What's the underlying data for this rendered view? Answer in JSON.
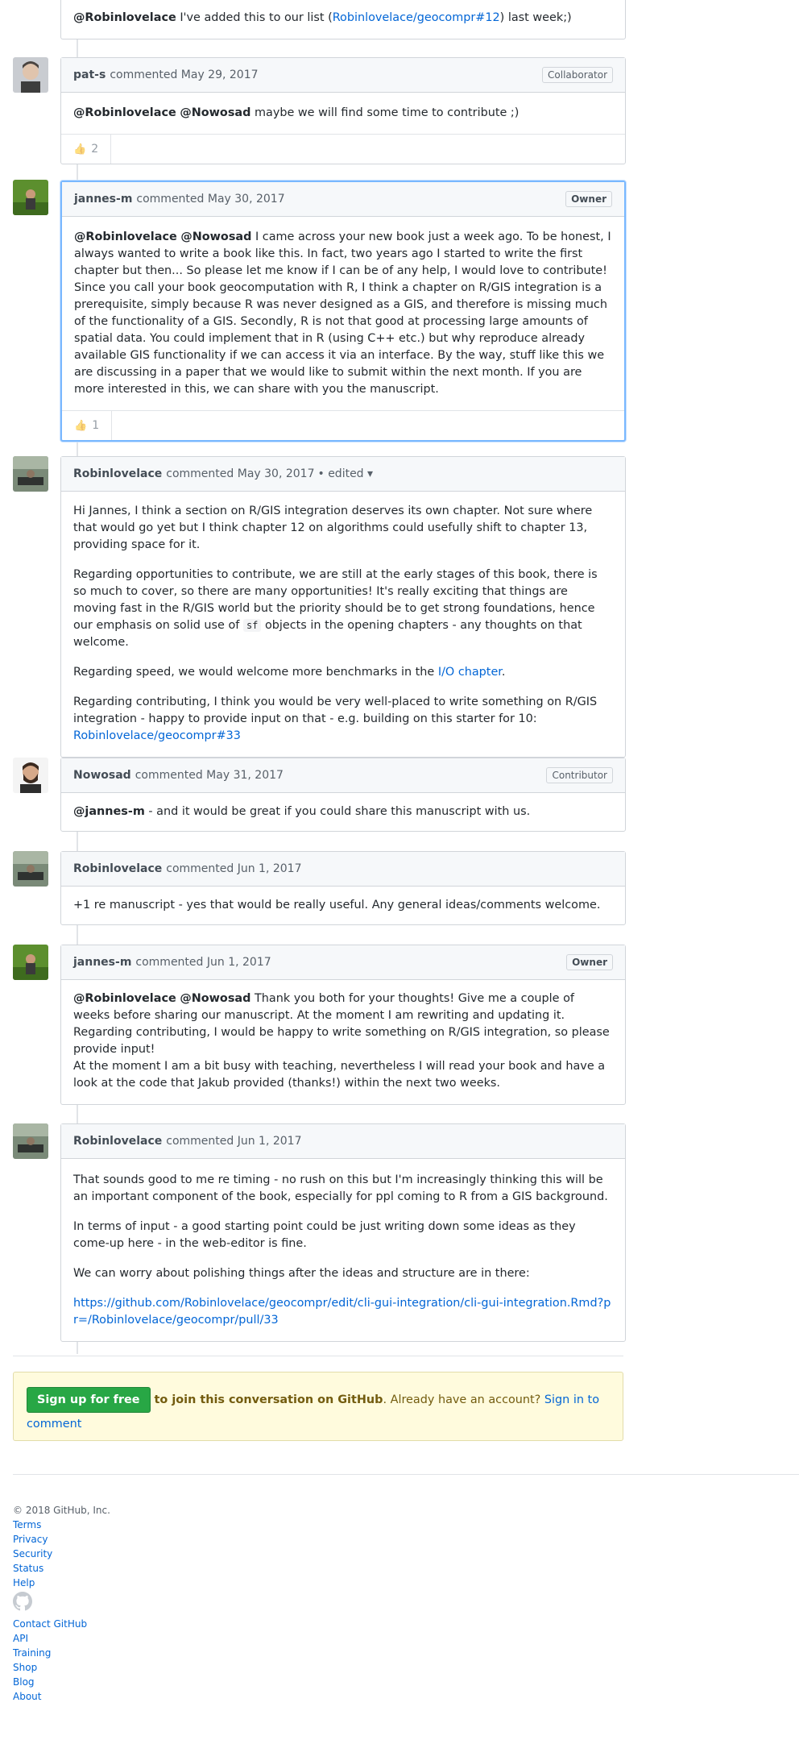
{
  "top_comment": {
    "text_before": "I've added this to our list (",
    "mention": "@Robinlovelace",
    "link": "Robinlovelace/geocompr#12",
    "text_after": ") last week;)"
  },
  "comments": [
    {
      "author": "pat-s",
      "action": "commented",
      "date": "May 29, 2017",
      "badge": "Collaborator",
      "mention1": "@Robinlovelace",
      "mention2": "@Nowosad",
      "text": " maybe we will find some time to contribute ;)",
      "reaction_count": "2"
    },
    {
      "author": "jannes-m",
      "action": "commented",
      "date": "May 30, 2017",
      "badge": "Owner",
      "mention1": "@Robinlovelace",
      "mention2": "@Nowosad",
      "text": " I came across your new book just a week ago. To be honest, I always wanted to write a book like this. In fact, two years ago I started to write the first chapter but then... So please let me know if I can be of any help, I would love to contribute! Since you call your book geocomputation with R, I think a chapter on R/GIS integration is a prerequisite, simply because R was never designed as a GIS, and therefore is missing much of the functionality of a GIS. Secondly, R is not that good at processing large amounts of spatial data. You could implement that in R (using C++ etc.) but why reproduce already available GIS functionality if we can access it via an interface. By the way, stuff like this we are discussing in a paper that we would like to submit within the next month. If you are more interested in this, we can share with you the manuscript.",
      "reaction_count": "1"
    },
    {
      "author": "Robinlovelace",
      "action": "commented",
      "date": "May 30, 2017",
      "edited": "• edited ▾",
      "p1": "Hi Jannes, I think a section on R/GIS integration deserves its own chapter. Not sure where that would go yet but I think chapter 12 on algorithms could usefully shift to chapter 13, providing space for it.",
      "p2a": "Regarding opportunities to contribute, we are still at the early stages of this book, there is so much to cover, so there are many opportunities! It's really exciting that things are moving fast in the R/GIS world but the priority should be to get strong foundations, hence our emphasis on solid use of ",
      "p2code": "sf",
      "p2b": " objects in the opening chapters - any thoughts on that welcome.",
      "p3a": "Regarding speed, we would welcome more benchmarks in the ",
      "p3link": "I/O chapter",
      "p3b": ".",
      "p4": "Regarding contributing, I think you would be very well-placed to write something on R/GIS integration - happy to provide input on that - e.g. building on this starter for 10:",
      "p4link": "Robinlovelace/geocompr#33"
    },
    {
      "author": "Nowosad",
      "action": "commented",
      "date": "May 31, 2017",
      "badge": "Contributor",
      "mention1": "@jannes-m",
      "text": " - and it would be great if you could share this manuscript with us."
    },
    {
      "author": "Robinlovelace",
      "action": "commented",
      "date": "Jun 1, 2017",
      "text": "+1 re manuscript - yes that would be really useful. Any general ideas/comments welcome."
    },
    {
      "author": "jannes-m",
      "action": "commented",
      "date": "Jun 1, 2017",
      "badge": "Owner",
      "mention1": "@Robinlovelace",
      "mention2": "@Nowosad",
      "text1": " Thank you both for your thoughts! Give me a couple of weeks before sharing our manuscript. At the moment I am rewriting and updating it. Regarding contributing, I would be happy to write something on R/GIS integration, so please provide input!",
      "text2": "At the moment I am a bit busy with teaching, nevertheless I will read your book and have a look at the code that Jakub provided (thanks!) within the next two weeks."
    },
    {
      "author": "Robinlovelace",
      "action": "commented",
      "date": "Jun 1, 2017",
      "p1": "That sounds good to me re timing - no rush on this but I'm increasingly thinking this will be an important component of the book, especially for ppl coming to R from a GIS background.",
      "p2": "In terms of input - a good starting point could be just writing down some ideas as they come-up here - in the web-editor is fine.",
      "p3": "We can worry about polishing things after the ideas and structure are in there:",
      "link": "https://github.com/Robinlovelace/geocompr/edit/cli-gui-integration/cli-gui-integration.Rmd?pr=/Robinlovelace/geocompr/pull/33"
    }
  ],
  "signup": {
    "button": "Sign up for free",
    "text_bold": " to join this conversation on GitHub",
    "text": ". Already have an account? ",
    "signin": "Sign in to comment"
  },
  "footer": {
    "copyright": "© 2018 GitHub, Inc.",
    "links1": [
      "Terms",
      "Privacy",
      "Security",
      "Status",
      "Help"
    ],
    "links2": [
      "Contact GitHub",
      "API",
      "Training",
      "Shop",
      "Blog",
      "About"
    ]
  },
  "colors": {
    "link": "#0366d6",
    "owner_highlight": "#79b8ff",
    "signup_bg": "#fffbdd",
    "signup_button": "#28a745"
  }
}
